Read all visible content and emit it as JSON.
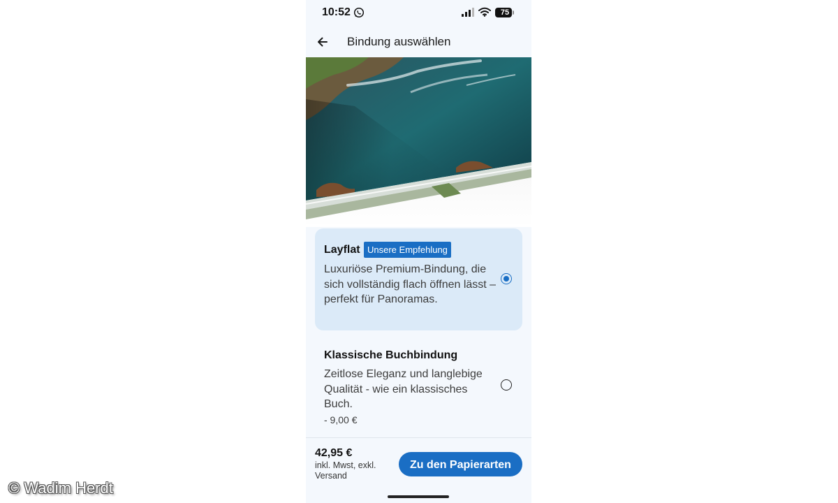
{
  "status_bar": {
    "time": "10:52",
    "battery": "75",
    "icons": [
      "whatsapp-icon",
      "signal-icon",
      "wifi-icon",
      "battery-icon"
    ]
  },
  "header": {
    "title": "Bindung auswählen",
    "back_icon": "arrow-left-icon"
  },
  "options": [
    {
      "title": "Layflat",
      "badge": "Unsere Empfehlung",
      "description": "Luxuriöse Premium-Bindung, die sich vollständig flach öffnen lässt – perfekt für Panoramas.",
      "selected": true
    },
    {
      "title": "Klassische Buchbindung",
      "description": "Zeitlose Eleganz und langlebige Qualität - wie ein klassisches Buch.",
      "price_delta": "- 9,00 €",
      "selected": false
    }
  ],
  "footer": {
    "price": "42,95 €",
    "tax_note": "inkl. Mwst, exkl. Versand",
    "cta_label": "Zu den Papierarten"
  },
  "watermark": "© Wadim Herdt",
  "colors": {
    "accent": "#1a6ec4",
    "selected_card": "#dbeaf8",
    "background": "#f4f8fd"
  }
}
